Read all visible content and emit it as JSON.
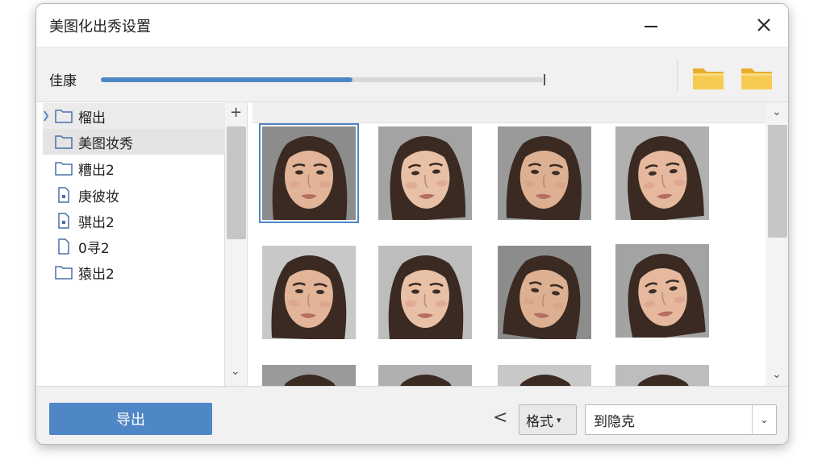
{
  "window": {
    "title": "美图化出秀设置"
  },
  "progress": {
    "label": "佳康",
    "percent": 57
  },
  "tree": {
    "items": [
      {
        "label": "榴出",
        "icon": "folder-icon",
        "expanded": true,
        "state": "highlight"
      },
      {
        "label": "美图妆秀",
        "icon": "folder-icon",
        "state": "selected"
      },
      {
        "label": "糟出2",
        "icon": "folder-icon"
      },
      {
        "label": "庚彼妆",
        "icon": "file-icon"
      },
      {
        "label": "骐出2",
        "icon": "file-icon"
      },
      {
        "label": "0寻2",
        "icon": "file-icon"
      },
      {
        "label": "猿出2",
        "icon": "folder-icon"
      }
    ]
  },
  "footer": {
    "export_label": "导出",
    "back_symbol": "<",
    "format_label": "格式",
    "destination_value": "到隐克"
  },
  "colors": {
    "accent": "#4f86c6",
    "folder": "#f5c54b"
  }
}
